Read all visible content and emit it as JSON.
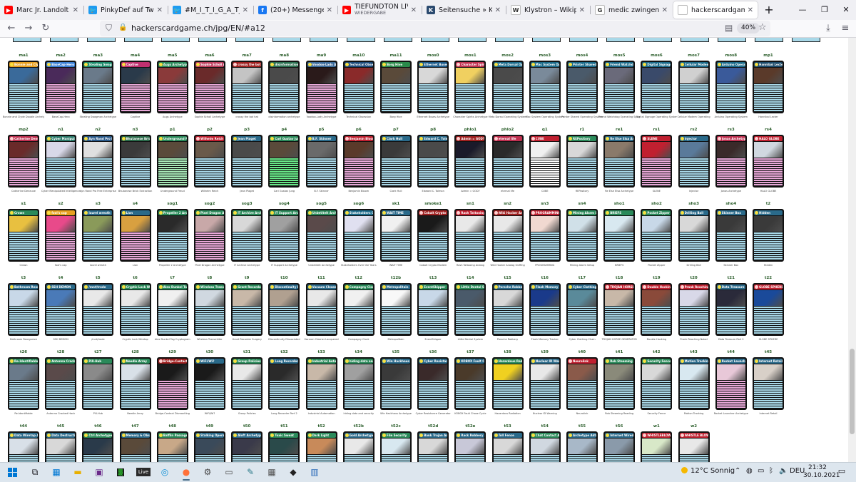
{
  "browser": {
    "tabs": [
      {
        "title": "Marc Jr. Landolt - YouTu",
        "icon": "youtube-icon",
        "color": "#ff0000",
        "glyph": "▶"
      },
      {
        "title": "PinkyDef auf Twitter: \"@",
        "icon": "twitter-icon",
        "color": "#1d9bf0",
        "glyph": "🐦"
      },
      {
        "title": "#M_I_T_I_G_A_T_I_O_N -",
        "icon": "twitter-icon",
        "color": "#1d9bf0",
        "glyph": "🐦"
      },
      {
        "title": "(20+) Messenger | Faceb",
        "icon": "facebook-icon",
        "color": "#1877f2",
        "glyph": "f"
      },
      {
        "title": "TIEFUNDTON LIVE@100",
        "subtitle": "WIEDERGABE",
        "icon": "youtube-icon",
        "color": "#ff0000",
        "glyph": "▶"
      },
      {
        "title": "Seitensuche » KinoX.TO",
        "icon": "kinox-icon",
        "color": "#2b4a6f",
        "glyph": "K"
      },
      {
        "title": "Klystron – Wikipedia",
        "icon": "wikipedia-icon",
        "color": "#ffffff",
        "glyph": "W"
      },
      {
        "title": "medic zwingend benötig",
        "icon": "google-icon",
        "color": "#ffffff",
        "glyph": "G"
      },
      {
        "title": "hackerscardgame.ch/jpg/EN",
        "icon": "page-icon",
        "color": "#ffffff",
        "glyph": "",
        "active": true
      }
    ],
    "new_tab": "+",
    "url": "hackerscardgame.ch/jpg/EN/#a12",
    "zoom": "40%"
  },
  "grid": {
    "rows": [
      {
        "codes": [
          "ma1",
          "ma2",
          "ma3",
          "ma4",
          "ma5",
          "ma6",
          "ma7",
          "ma8",
          "ma9",
          "ma10",
          "ma11",
          "mos0",
          "mos1",
          "mos2",
          "mos3",
          "mos4",
          "mos5",
          "mos6",
          "mos7",
          "mos8",
          "mp1"
        ],
        "names": [
          "Bonnie and Clyde Double Archetype",
          "BaseCap-Hero",
          "Stealing Swagman Archetype",
          "Captive",
          "Augs Archetype",
          "Sophie Scholl Archetype",
          "crossy the bot hat",
          "disinformation archetype",
          "Voodoo-Lady Archetype",
          "Technical Obsession",
          "Borg Hive",
          "Ethernet Buses Archetype",
          "Character Spirits Archetype",
          "Meta Dorsal Operating System",
          "Mac System Operating System",
          "Printer Shared Operating System",
          "Friend Watchdog Operating System",
          "Digital Signage Operating System",
          "Cellular Modem Operating",
          "Arduino Operating System",
          "Hannibal Lecter"
        ],
        "header_colors": [
          "#e8a020",
          "#3a7fd5",
          "#1a8a6a",
          "#c03070",
          "#2a8a5a",
          "#c04060",
          "#a02020",
          "#2a7050",
          "#3a6a9a",
          "#1a4a7a",
          "#2a8a4a",
          "#1a5a8a",
          "#c03050",
          "#1a6a8a",
          "#1a6a8a",
          "#1a6a8a",
          "#1a6a8a",
          "#1a6a8a",
          "#1a6a8a",
          "#1a6a8a",
          "#1a4a6a"
        ],
        "body_colors": [
          "#a8d8e8",
          "#e8a8d8",
          "#a8d8e8",
          "#e8a8d8",
          "#e8a8d8",
          "#e8a8d8",
          "#a8d8e8",
          "#a8d8e8",
          "#e8a8d8",
          "#a8d8e8",
          "#a8d8e8",
          "#a8d8e8",
          "#a8d8e8",
          "#a8d8e8",
          "#a8d8e8",
          "#a8d8e8",
          "#a8d8e8",
          "#a8d8e8",
          "#a8d8e8",
          "#a8d8e8",
          "#a8d8e8"
        ],
        "image_colors": [
          "#3a6a9a",
          "#4a2a5a",
          "#6a7a8a",
          "#2a3a4a",
          "#8a3a3a",
          "#6a2a2a",
          "#c4c4c4",
          "#4a4a4a",
          "#2a1a1a",
          "#8a2a2a",
          "#5a4a3a",
          "#d8d8d8",
          "#f0d060",
          "#4a4a4a",
          "#7a8a9a",
          "#4a5a6a",
          "#6a6a7a",
          "#3a4a6a",
          "#d0d0d0",
          "#3a5a9a",
          "#5a3a2a"
        ]
      },
      {
        "codes": [
          "mp2",
          "n1",
          "n2",
          "n3",
          "p1",
          "p2",
          "p3",
          "p4",
          "p5",
          "p6",
          "p7",
          "p8",
          "phlo1",
          "phlo2",
          "q1",
          "r1",
          "re1",
          "rs1",
          "rs2",
          "rs3",
          "rs4"
        ],
        "names": [
          "Catherine Deneuve",
          "Cyber Manipulated Intelligence",
          "Ayn Rand Pro Free Enterprise",
          "Bhutanese Brick Extraction",
          "Underground Freud",
          "Wilhelm Reich",
          "Jean Piaget",
          "Carl Gustav Jung",
          "B.F. Skinner",
          "Benjamin Bloom",
          "Clark Hull",
          "Edward C. Tolman",
          "Admin = GOD?",
          "eternal life",
          "CUBE",
          "REPository",
          "Re Else Elsa Archetype",
          "SLENE",
          "Injector",
          "Jonas Archetype",
          "HALO GLOBE"
        ],
        "header_colors": [
          "#c03050",
          "#2a7a6a",
          "#2a5a8a",
          "#2a6a4a",
          "#2a8a5a",
          "#c02030",
          "#2a6a8a",
          "#2a8a5a",
          "#2a6a8a",
          "#c02030",
          "#2a6a8a",
          "#2a6a8a",
          "#a02020",
          "#c03050",
          "#c02030",
          "#2a8a5a",
          "#2a6a8a",
          "#c02030",
          "#2a6a8a",
          "#c03050",
          "#c02030"
        ],
        "body_colors": [
          "#e8a8d8",
          "#a8d8e8",
          "#a8d8e8",
          "#a8d8e8",
          "#a8e8b8",
          "#a8d8e8",
          "#a8d8e8",
          "#68e888",
          "#a8d8e8",
          "#e8a8d8",
          "#a8d8e8",
          "#a8d8e8",
          "#a8d8e8",
          "#a8d8e8",
          "#ffffff",
          "#a8d8e8",
          "#a8d8e8",
          "#e8a8d8",
          "#a8d8e8",
          "#e8a8d8",
          "#e8a8d8"
        ],
        "image_colors": [
          "#6a2a2a",
          "#d8d8e8",
          "#e0e0e0",
          "#3a3a3a",
          "#5a4a3a",
          "#6a5a4a",
          "#4a4a4a",
          "#5a4a3a",
          "#6a6a6a",
          "#5a3a2a",
          "#3a3a3a",
          "#4a4a4a",
          "#1a1a2a",
          "#2a2a2a",
          "#f0f0f0",
          "#d8d8d8",
          "#8a7a6a",
          "#c02030",
          "#5a7a9a",
          "#3a2a2a",
          "#d0d8e0"
        ]
      },
      {
        "codes": [
          "s1",
          "s2",
          "s3",
          "s4",
          "sog1",
          "sog2",
          "sog3",
          "sog4",
          "sog5",
          "sog6",
          "sk1",
          "smoke1",
          "sn1",
          "sn2",
          "sn3",
          "sn4",
          "sho1",
          "sho2",
          "sho3",
          "sho4",
          "t2"
        ],
        "names": [
          "Crown",
          "fool's cap",
          "laurel wreath",
          "Lion",
          "Propeller 2 Archetype",
          "Pixel Dragon Archetype",
          "IT Archive Archetype",
          "IT Support Archetype",
          "Unbetitelt Archetype",
          "Stakeholders Over the Years",
          "WAIT TIME",
          "Cobalt Crypto Modem",
          "Rash Tattooing Analog",
          "Wiki Hacker Analog Sniffing",
          "PROGRAMMING",
          "Mining Alarm Setup",
          "BRIEFS",
          "Pocket Zipper",
          "Drilling Ball",
          "Skinner Box",
          "Hidden"
        ],
        "header_colors": [
          "#2a8a5a",
          "#e8a020",
          "#2a6a8a",
          "#2a6a8a",
          "#2a8a5a",
          "#2a8a5a",
          "#2a8a5a",
          "#2a8a5a",
          "#2a8a5a",
          "#1a6a8a",
          "#2a6a8a",
          "#a02020",
          "#c02030",
          "#a02020",
          "#c02030",
          "#2a8a5a",
          "#2a8a5a",
          "#2a8a5a",
          "#2a6a8a",
          "#2a6a8a",
          "#2a6a8a"
        ],
        "body_colors": [
          "#a8d8e8",
          "#e8a8d8",
          "#a8d8e8",
          "#e8a8d8",
          "#a8d8e8",
          "#e8a8d8",
          "#a8d8e8",
          "#a8d8e8",
          "#a8d8e8",
          "#a8d8e8",
          "#a8d8e8",
          "#a8d8e8",
          "#a8d8e8",
          "#a8d8e8",
          "#a8d8e8",
          "#a8d8e8",
          "#a8d8e8",
          "#a8d8e8",
          "#a8d8e8",
          "#a8d8e8",
          "#a8d8e8"
        ],
        "image_colors": [
          "#e8c040",
          "#e84a8a",
          "#8a9a5a",
          "#d8a040",
          "#2a2a2a",
          "#c8a8a8",
          "#d8d8d8",
          "#a0a0a0",
          "#5a4a4a",
          "#e0e0f0",
          "#f0f0f0",
          "#1a1a1a",
          "#e8e8e8",
          "#e8e8e8",
          "#f0d8d0",
          "#d0e0e8",
          "#d8e8f0",
          "#c8d8e8",
          "#d8d8d8",
          "#3a3a3a",
          "#3a3a3a"
        ]
      },
      {
        "codes": [
          "t3",
          "t4",
          "t5",
          "t6",
          "t7",
          "t8",
          "t9",
          "t10",
          "t11",
          "t12",
          "t12b",
          "t13",
          "t14",
          "t15",
          "t16",
          "t17",
          "t18",
          "t19",
          "t20",
          "t21",
          "t22"
        ],
        "names": [
          "Bathroom Reorganize",
          "SSH DEMON",
          "/mnt/trode",
          "Cryptic Lock Wiretap",
          "Alex Dunkel Tag Cryptogram",
          "Wireless Transmitter",
          "Grant Recordar Surgery",
          "Discontinuity Dissociated",
          "Vacuum Cleaner Lacquered",
          "Compagny Clock",
          "Metropolitain",
          "EventSkipper",
          "Little Dental System",
          "Porsche Robbery",
          "Flash Memory Tracker",
          "Cyber Clothing Chain",
          "TROJAN HORSE GENERATOR",
          "Double Hacking",
          "Prank Reaching Nobel",
          "Data Treasure Part 2",
          "GLOBE SPHERE"
        ],
        "header_colors": [
          "#2a6a8a",
          "#2a6a8a",
          "#2a6a8a",
          "#2a8a5a",
          "#2a8a5a",
          "#2a8a5a",
          "#2a8a5a",
          "#2a6a8a",
          "#2a6a8a",
          "#2a8a5a",
          "#2a6a8a",
          "#2a8a5a",
          "#2a8a5a",
          "#2a6a8a",
          "#2a6a8a",
          "#2a6a8a",
          "#c02030",
          "#c02030",
          "#c02030",
          "#2a6a8a",
          "#c02030"
        ],
        "body_colors": [
          "#a8d8e8",
          "#a8d8e8",
          "#a8d8e8",
          "#a8d8e8",
          "#a8d8e8",
          "#a8d8e8",
          "#a8d8e8",
          "#a8d8e8",
          "#a8d8e8",
          "#a8d8e8",
          "#a8d8e8",
          "#a8d8e8",
          "#a8d8e8",
          "#a8d8e8",
          "#a8d8e8",
          "#a8d8e8",
          "#a8d8e8",
          "#a8d8e8",
          "#a8d8e8",
          "#a8d8e8",
          "#a8d8e8"
        ],
        "image_colors": [
          "#c8d8e8",
          "#4a7ab8",
          "#e8e8e8",
          "#e8e8e8",
          "#f0f0f0",
          "#d0d8e0",
          "#c8b8a8",
          "#b0a090",
          "#e8e8e8",
          "#f0f0f0",
          "#f8f8f8",
          "#c8d8e8",
          "#4a5a6a",
          "#d8d8d8",
          "#1a3a8a",
          "#5a8a9a",
          "#c8b8a8",
          "#8a4a3a",
          "#d8d8e8",
          "#2a2a3a",
          "#1a4a9a"
        ]
      },
      {
        "codes": [
          "t26",
          "t28",
          "t27",
          "t28",
          "t29",
          "t30",
          "t31",
          "t32",
          "t33",
          "t34",
          "t35",
          "t36",
          "t37",
          "t38",
          "t39",
          "t40",
          "t41",
          "t42",
          "t43",
          "t44",
          "t45"
        ],
        "names": [
          "Re-Identifiable",
          "Antenna Cracked Hack",
          "Pill-Hub",
          "Needle Array",
          "Bridge-Contact Dismantling",
          "WiFi/Wi?",
          "Group Policies",
          "Long Recorder Part 2",
          "Industrial Automation",
          "hiding data and security",
          "Win Hackhaus Archetype",
          "Cyber Resistance Generator",
          "KOBOX Fault Chase Cycle",
          "Hazardous Radiation",
          "Nuclear ID Warning",
          "Neurolink",
          "Rob Steaming Reading",
          "Security Fence",
          "Motion Tracking",
          "Rocket Launcher Archetype",
          "Internet Retail"
        ],
        "header_colors": [
          "#2a8a5a",
          "#2a8a5a",
          "#2a8a5a",
          "#2a8a5a",
          "#a02020",
          "#2a6a8a",
          "#2a8a5a",
          "#2a6a8a",
          "#2a8a5a",
          "#2a8a5a",
          "#2a6a8a",
          "#2a6a8a",
          "#2a6a8a",
          "#2a8a5a",
          "#2a6a8a",
          "#c02030",
          "#2a8a5a",
          "#2a8a5a",
          "#2a6a8a",
          "#2a6a8a",
          "#2a6a8a"
        ],
        "body_colors": [
          "#a8d8e8",
          "#a8d8e8",
          "#a8d8e8",
          "#a8d8e8",
          "#e8a8d8",
          "#a8d8e8",
          "#a8d8e8",
          "#a8d8e8",
          "#a8d8e8",
          "#a8d8e8",
          "#a8d8e8",
          "#a8d8e8",
          "#a8d8e8",
          "#a8d8e8",
          "#a8d8e8",
          "#a8d8e8",
          "#a8d8e8",
          "#a8d8e8",
          "#a8d8e8",
          "#e8a8d8",
          "#a8d8e8"
        ],
        "image_colors": [
          "#6a7a8a",
          "#5a4a4a",
          "#8a8a8a",
          "#d8e0e8",
          "#1a1a1a",
          "#1a1a1a",
          "#e8e8e8",
          "#2a2a2a",
          "#c8b8a8",
          "#a0a0a0",
          "#3a3a3a",
          "#3a2a2a",
          "#4a3a2a",
          "#f0d020",
          "#e8e8e8",
          "#8a5a4a",
          "#8a8a7a",
          "#d8d8d8",
          "#d8e8f0",
          "#e8c8d8",
          "#d8d0c8"
        ]
      },
      {
        "codes": [
          "t44",
          "t45",
          "t46",
          "t47",
          "t48",
          "t49",
          "t50",
          "t51",
          "t52",
          "t52b",
          "t52c",
          "t52d",
          "t52e",
          "t53",
          "t54",
          "t55",
          "t56",
          "w1",
          "w2"
        ],
        "names": [
          "Data Wiretap Archetype",
          "Data Destruction Archetype",
          "Ctrl Archetype",
          "Memory & Obscure",
          "Bafflin Passage Archetype",
          "Stalking Operator",
          "Aloft Archetype",
          "Toxic Sweat",
          "Dark Light",
          "Gold Archetype",
          "File Security",
          "Bank Trojan Archetype",
          "Rack Robbery",
          "Toll Fence",
          "Chat Contact Archetype",
          "Archetype Aktivitet",
          "Internet Wired Secretary",
          "WHISTLEBLOWER",
          "WHISTLE BLOWER"
        ],
        "header_colors": [
          "#2a6a8a",
          "#2a6a8a",
          "#2a8a5a",
          "#2a6a8a",
          "#2a8a5a",
          "#2a6a8a",
          "#2a6a8a",
          "#2a8a5a",
          "#2a8a5a",
          "#2a6a8a",
          "#2a8a5a",
          "#2a6a8a",
          "#2a6a8a",
          "#2a6a8a",
          "#2a8a5a",
          "#2a6a8a",
          "#2a6a8a",
          "#c02030",
          "#c02030"
        ],
        "body_colors": [
          "#a8d8e8",
          "#a8d8e8",
          "#a8d8e8",
          "#a8d8e8",
          "#a8d8e8",
          "#a8d8e8",
          "#a8d8e8",
          "#a8d8e8",
          "#a8d8e8",
          "#a8d8e8",
          "#a8d8e8",
          "#a8d8e8",
          "#a8d8e8",
          "#a8d8e8",
          "#a8d8e8",
          "#a8d8e8",
          "#a8d8e8",
          "#a8d8e8",
          "#a8d8e8"
        ],
        "image_colors": [
          "#d8e0e8",
          "#d8d8d8",
          "#2a3a4a",
          "#5a4a3a",
          "#c8a888",
          "#3a4a5a",
          "#3a3a4a",
          "#2a4a4a",
          "#c88a5a",
          "#e8e8e8",
          "#d8e8f0",
          "#d8d8d8",
          "#c8c8d8",
          "#d8d8d8",
          "#d0d8e0",
          "#a8b8c8",
          "#8a9aaa",
          "#d8e8c8",
          "#e8e8e8"
        ]
      }
    ]
  },
  "taskbar": {
    "live_label": "Live",
    "weather": "12°C  Sonnig",
    "language": "DEU",
    "time": "21:32",
    "date": "30.10.2021"
  }
}
